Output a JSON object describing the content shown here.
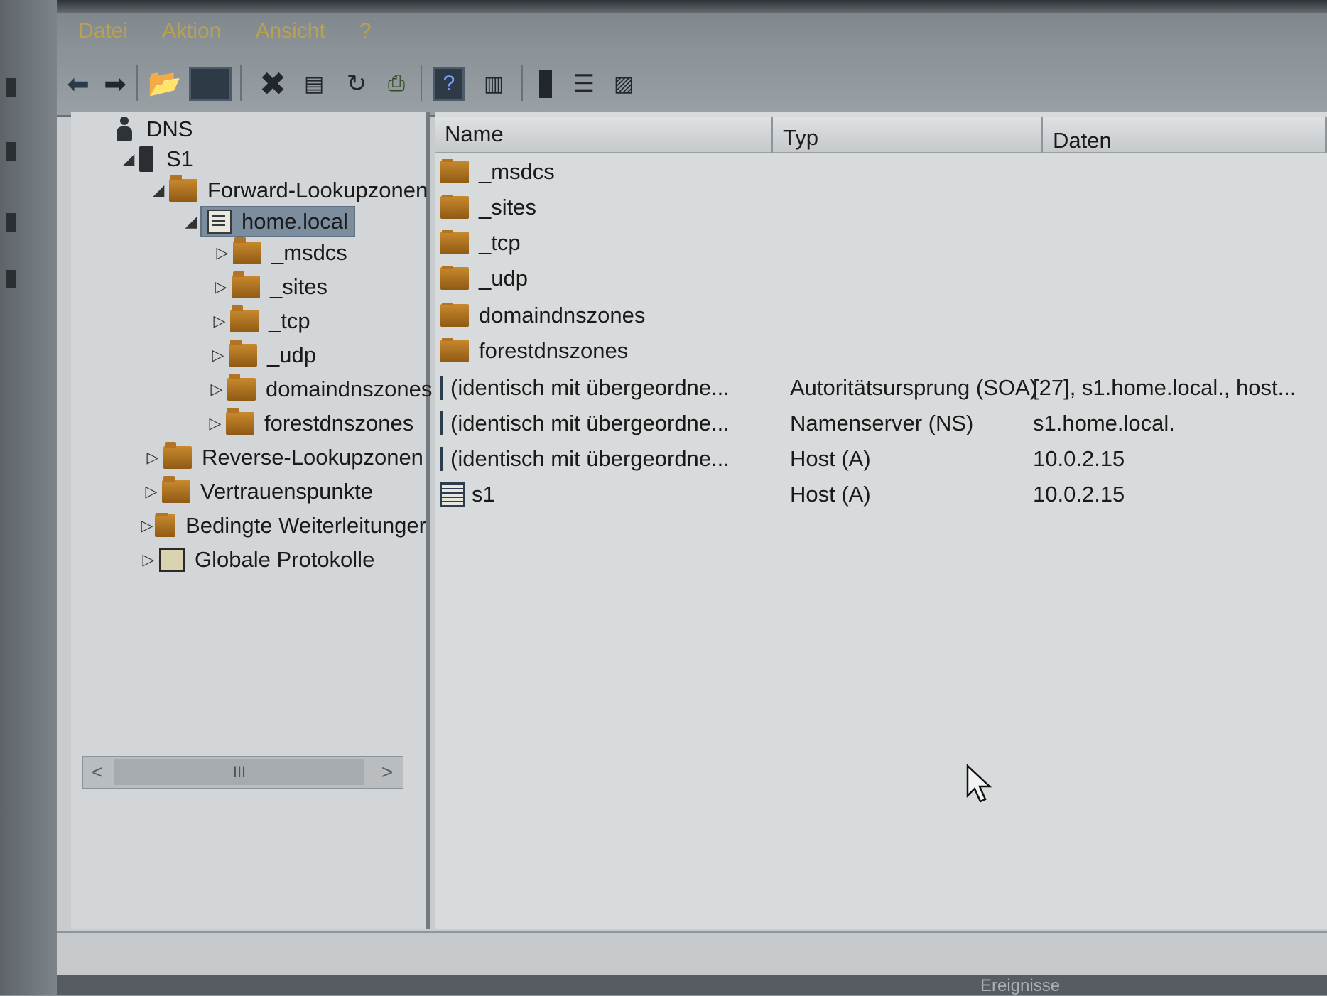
{
  "menu": [
    "Datei",
    "Aktion",
    "Ansicht",
    "?"
  ],
  "toolbar": {
    "icons": [
      "back-arrow-icon",
      "forward-arrow-icon",
      "folder-up-icon",
      "console-tree-icon",
      "delete-icon",
      "properties-icon",
      "refresh-icon",
      "export-list-icon",
      "help-icon",
      "console-view-icon",
      "server-icon",
      "list-view-icon",
      "zone-properties-icon"
    ]
  },
  "tree": {
    "root": "DNS",
    "server": "S1",
    "forward": "Forward-Lookupzonen",
    "zone": "home.local",
    "zone_children": [
      "_msdcs",
      "_sites",
      "_tcp",
      "_udp",
      "domaindnszones",
      "forestdnszones"
    ],
    "reverse": "Reverse-Lookupzonen",
    "trust": "Vertrauenspunkte",
    "conditional": "Bedingte Weiterleitunger",
    "logs": "Globale Protokolle"
  },
  "list": {
    "columns": [
      "Name",
      "Typ",
      "Daten"
    ],
    "rows": [
      {
        "name": "_msdcs",
        "type": "",
        "data": "",
        "icon": "folder"
      },
      {
        "name": "_sites",
        "type": "",
        "data": "",
        "icon": "folder"
      },
      {
        "name": "_tcp",
        "type": "",
        "data": "",
        "icon": "folder"
      },
      {
        "name": "_udp",
        "type": "",
        "data": "",
        "icon": "folder"
      },
      {
        "name": "domaindnszones",
        "type": "",
        "data": "",
        "icon": "folder"
      },
      {
        "name": "forestdnszones",
        "type": "",
        "data": "",
        "icon": "folder"
      },
      {
        "name": "(identisch mit übergeordne...",
        "type": "Autoritätsursprung (SOA)",
        "data": "[27], s1.home.local., host...",
        "icon": "record"
      },
      {
        "name": "(identisch mit übergeordne...",
        "type": "Namenserver (NS)",
        "data": "s1.home.local.",
        "icon": "record"
      },
      {
        "name": "(identisch mit übergeordne...",
        "type": "Host (A)",
        "data": "10.0.2.15",
        "icon": "record"
      },
      {
        "name": "s1",
        "type": "Host (A)",
        "data": "10.0.2.15",
        "icon": "record"
      }
    ]
  },
  "scrollbar": {
    "grip": "III",
    "left": "<",
    "right": ">"
  },
  "taskbar": {
    "label": "Ereignisse"
  },
  "colors": {
    "selection": "#7c8d9e",
    "folder": "#c98a2e",
    "menu_text": "#b9a24f"
  }
}
